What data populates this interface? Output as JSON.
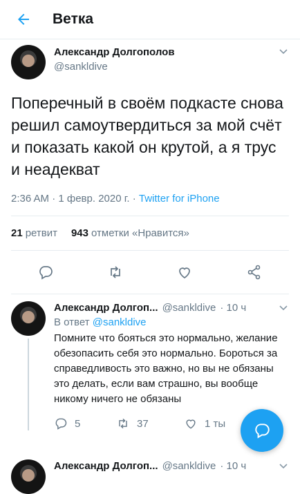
{
  "header": {
    "title": "Ветка"
  },
  "main_tweet": {
    "author_name": "Александр Долгополов",
    "handle": "@sankldive",
    "text": "Поперечный в своём подкасте снова решил самоутвердиться за мой счёт и показать какой он крутой, а я трус и неадекват",
    "time": "2:36 AM · 1 февр. 2020 г. · ",
    "source": "Twitter for iPhone",
    "retweets_count": "21",
    "retweets_label": "ретвит",
    "likes_count": "943",
    "likes_label": "отметки «Нравится»",
    "icons": [
      "reply-icon",
      "retweet-icon",
      "like-icon",
      "share-icon"
    ]
  },
  "reply1": {
    "author_name": "Александр Долгоп...",
    "handle": "@sankldive",
    "time": "· 10 ч",
    "in_reply_prefix": "В ответ ",
    "in_reply_handle": "@sankldive",
    "text": "Помните что бояться это нормально, желание обезопасить себя это нормально. Бороться за справедливость это важно, но вы не обязаны это делать, если вам страшно, вы вообще никому ничего не обязаны",
    "replies": "5",
    "retweets": "37",
    "likes": "1 ты"
  },
  "reply2": {
    "author_name": "Александр Долгоп...",
    "handle": "@sankldive",
    "time": "· 10 ч"
  },
  "colors": {
    "accent": "#1da1f2",
    "muted": "#657786"
  }
}
